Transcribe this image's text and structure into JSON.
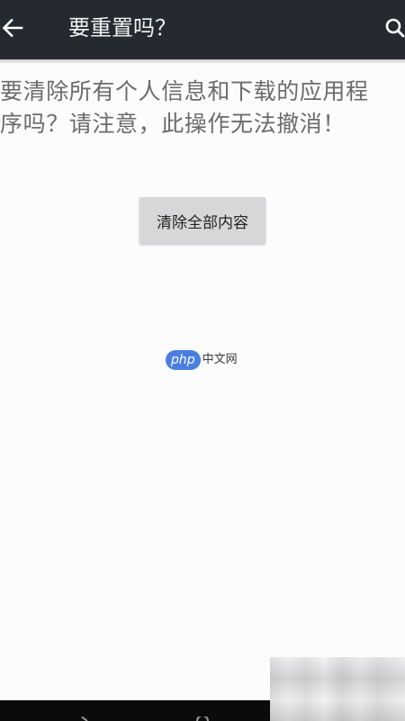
{
  "action_bar": {
    "title": "要重置吗？",
    "back_icon": "arrow-left-icon",
    "search_icon": "search-icon",
    "background": "#252a31"
  },
  "dialog": {
    "message_line1": "要清除所有个人信息和下载的应用程",
    "message_line2": "序吗？请注意，此操作无法撤消！",
    "button_label": "清除全部内容"
  },
  "watermark": {
    "badge": "php",
    "text": "中文网",
    "accent": "#4a7fe0"
  },
  "nav_bar": {
    "back_icon": "nav-back-icon",
    "home_icon": "nav-home-icon"
  }
}
